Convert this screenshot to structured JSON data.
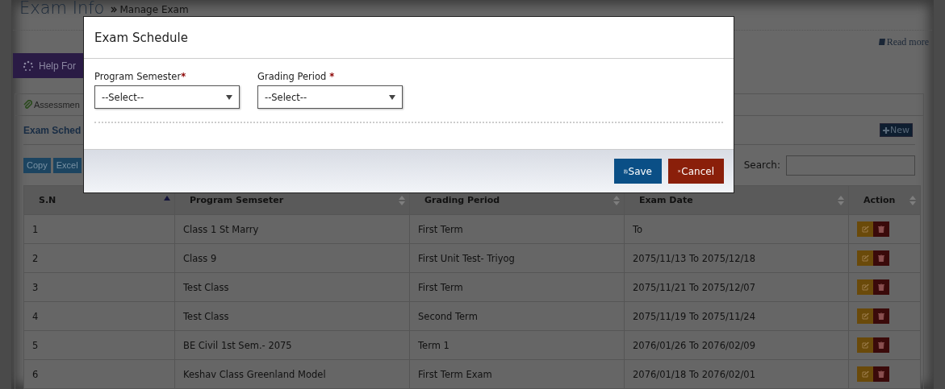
{
  "page": {
    "title": "Exam Info",
    "breadcrumb": "Manage Exam",
    "read_more": "Read more",
    "help_button": "Help For",
    "tab": "Assessmen",
    "panel_title": "Exam Sched",
    "new_button": "New",
    "export_buttons": [
      "Copy",
      "Excel"
    ],
    "search_label": "Search:"
  },
  "table": {
    "columns": [
      {
        "label": "S.N",
        "sorted": true
      },
      {
        "label": "Program Semseter",
        "sorted": false
      },
      {
        "label": "Grading Period",
        "sorted": false
      },
      {
        "label": "Exam Date",
        "sorted": false
      },
      {
        "label": "Action",
        "sorted": false
      }
    ],
    "rows": [
      [
        "1",
        "Class 1 St Marry",
        "First Term",
        "To"
      ],
      [
        "2",
        "Class 9",
        "First Unit Test- Triyog",
        "2075/11/13 To 2075/12/18"
      ],
      [
        "3",
        "Test Class",
        "First Term",
        "2075/11/21 To 2075/12/07"
      ],
      [
        "4",
        "Test Class",
        "Second Term",
        "2075/11/19 To 2075/11/24"
      ],
      [
        "5",
        "BE Civil 1st Sem.- 2075",
        "Term 1",
        "2076/01/26 To 2076/02/09"
      ],
      [
        "6",
        "Keshav Class Greenland Model",
        "First Term Exam",
        "2076/01/18 To 2076/02/01"
      ]
    ]
  },
  "modal": {
    "title": "Exam Schedule",
    "fields": [
      {
        "label": "Program Semester",
        "mark": "*",
        "value": "--Select--"
      },
      {
        "label": "Grading Period",
        "mark": "*",
        "value": "--Select--"
      }
    ],
    "buttons": [
      {
        "kind": "save",
        "label": "Save"
      },
      {
        "kind": "cancel",
        "label": "Cancel"
      }
    ]
  }
}
